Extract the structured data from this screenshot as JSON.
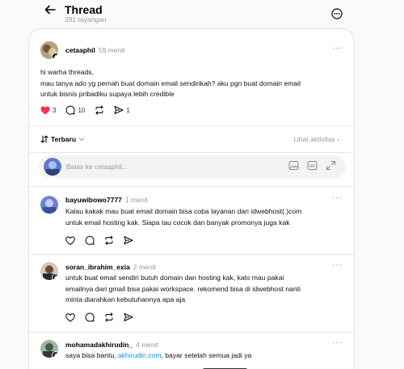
{
  "header": {
    "title": "Thread",
    "views": "391 tayangan"
  },
  "post": {
    "username": "cetaaphil",
    "time": "59 menit",
    "text_line1": "hi warha threads,",
    "text_line2": "mau tanya ado yg pernah buat domain email sendirikah? aku pgn buat domain email",
    "text_line3": "untuk bisnis pribadiku supaya lebih credible",
    "likes": "3",
    "comments": "10",
    "shares": "1",
    "like_color": "#ff3040"
  },
  "sort": {
    "label": "Terbaru",
    "activity": "Lihat aktivitas"
  },
  "reply_box": {
    "placeholder": "Balas ke cetaaphil..."
  },
  "replies": [
    {
      "username": "bayuwibowo7777",
      "time": "1 menit",
      "line1": "Kalau kakak mau buat email domain bisa coba layanan dari idwebhost(.)com",
      "line2": "untuk email hosting kak. Siapa tau cocok dan banyak promonya juga kak"
    },
    {
      "username": "soran_ibrahim_exia",
      "time": "2 menit",
      "line1": "untuk buat email sendiri butuh domain dan hosting kak, kalo mau pakai",
      "line2": "emailnya dari gmail bisa pakai workspace. rekomend bisa di idwebhost nanti",
      "line3": "minta diarahkan kebutuhannya apa aja"
    },
    {
      "username": "mohamadakhirudin_",
      "time": "4 menit",
      "line1_pre": "saya bisa bantu, ",
      "line1_link": "akhirudin.com",
      "line1_post": ", bayar setelah semua jadi ya"
    }
  ]
}
